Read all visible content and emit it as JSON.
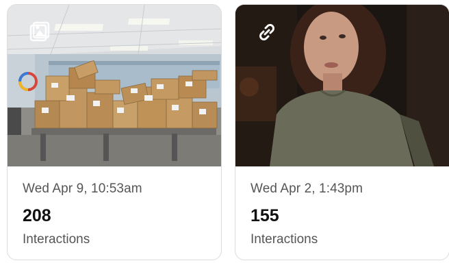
{
  "posts": [
    {
      "media_type_icon": "image-icon",
      "date": "Wed Apr 9, 10:53am",
      "interactions_count": "208",
      "interactions_label": "Interactions"
    },
    {
      "media_type_icon": "link-icon",
      "date": "Wed Apr 2, 1:43pm",
      "interactions_count": "155",
      "interactions_label": "Interactions"
    }
  ]
}
